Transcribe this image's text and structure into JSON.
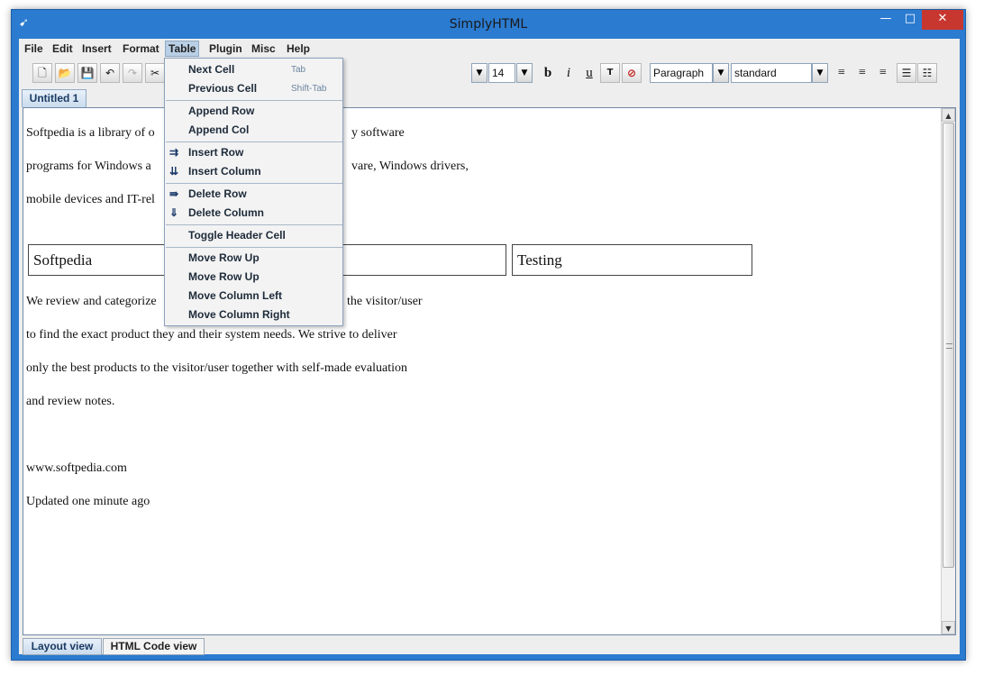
{
  "window": {
    "title": "SimplyHTML",
    "minimize": "—",
    "maximize": "□",
    "close": "✕",
    "app_icon": "app-logo"
  },
  "menubar": {
    "items": [
      "File",
      "Edit",
      "Insert",
      "Format",
      "Table",
      "Plugin",
      "Misc",
      "Help"
    ],
    "active": "Table"
  },
  "toolbar": {
    "icons": [
      "new-document-icon",
      "open-folder-icon",
      "save-icon",
      "undo-icon",
      "redo-icon",
      "cut-icon"
    ],
    "font_size": "14",
    "bold_label": "b",
    "italic_label": "i",
    "underline_label": "u",
    "paragraph_style": "Paragraph",
    "stylesheet": "standard"
  },
  "document_tab": "Untitled 1",
  "editor": {
    "paragraphs": [
      "Softpedia is a library of o",
      "programs for Windows a",
      "mobile devices and IT-rel",
      "We review and categorize",
      "to find the exact product they and their system needs. We strive to deliver",
      "only the best products to the visitor/user together with self-made evaluation",
      "and review notes.",
      "www.softpedia.com",
      "Updated one minute ago"
    ],
    "right_fragments": [
      "y software",
      "vare, Windows drivers,",
      "the visitor/user"
    ],
    "table_cells": [
      "Softpedia",
      "",
      "Testing"
    ]
  },
  "bottom_tabs": [
    "Layout view",
    "HTML Code view"
  ],
  "table_menu": {
    "items": [
      {
        "label": "Next Cell",
        "shortcut": "Tab",
        "icon": ""
      },
      {
        "label": "Previous Cell",
        "shortcut": "Shift-Tab",
        "icon": ""
      },
      {
        "label": "Append Row",
        "shortcut": "",
        "icon": ""
      },
      {
        "label": "Append Col",
        "shortcut": "",
        "icon": ""
      },
      {
        "label": "Insert Row",
        "shortcut": "",
        "icon": "insert-row-icon"
      },
      {
        "label": "Insert Column",
        "shortcut": "",
        "icon": "insert-column-icon"
      },
      {
        "label": "Delete Row",
        "shortcut": "",
        "icon": "delete-row-icon"
      },
      {
        "label": "Delete Column",
        "shortcut": "",
        "icon": "delete-column-icon"
      },
      {
        "label": "Toggle Header Cell",
        "shortcut": "",
        "icon": ""
      },
      {
        "label": "Move Row Up",
        "shortcut": "",
        "icon": ""
      },
      {
        "label": "Move Row Up",
        "shortcut": "",
        "icon": ""
      },
      {
        "label": "Move Column Left",
        "shortcut": "",
        "icon": ""
      },
      {
        "label": "Move Column Right",
        "shortcut": "",
        "icon": ""
      }
    ]
  }
}
